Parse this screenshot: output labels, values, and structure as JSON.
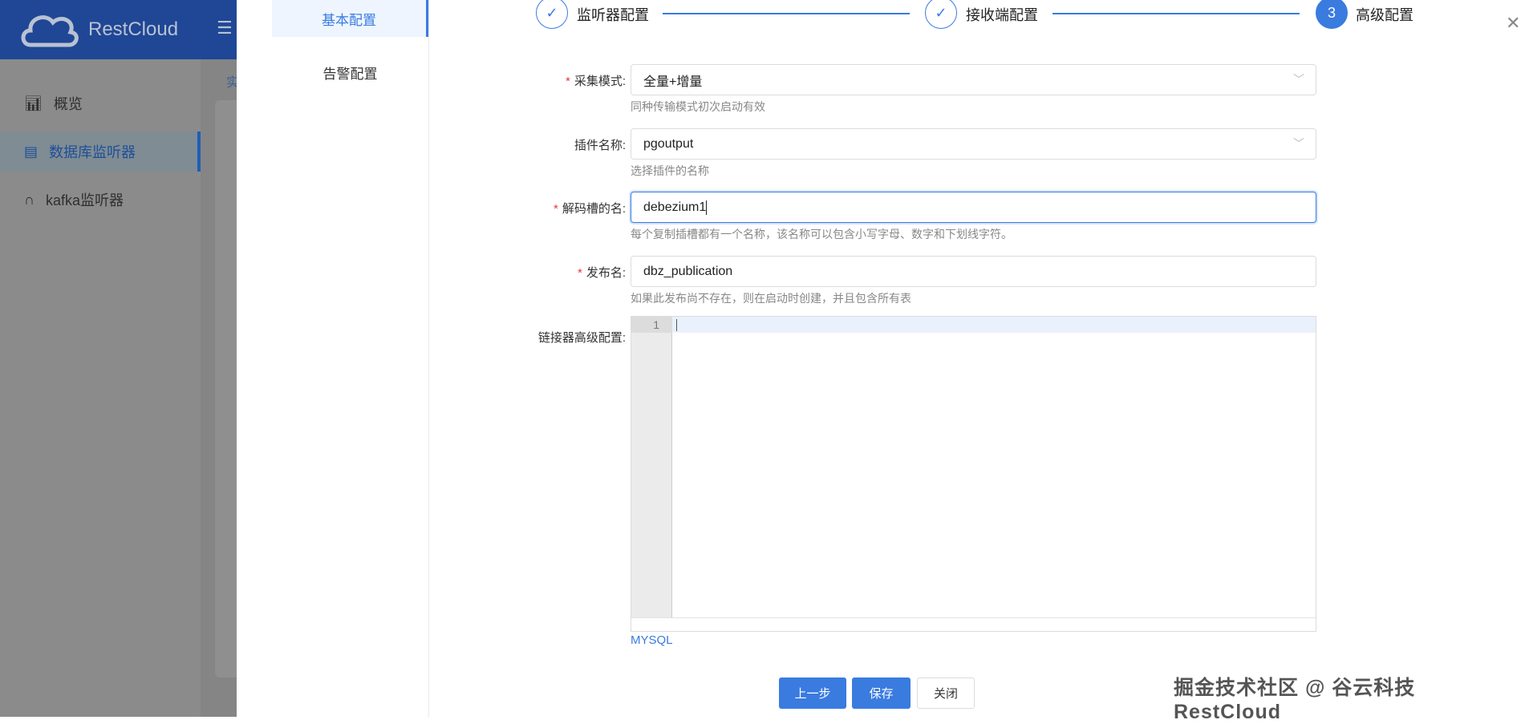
{
  "app": {
    "brand": "RestCloud"
  },
  "sidebar": {
    "items": [
      {
        "label": "概览",
        "icon": "bar-chart-icon"
      },
      {
        "label": "数据库监听器",
        "icon": "database-icon",
        "active": true
      },
      {
        "label": "kafka监听器",
        "icon": "headset-icon"
      }
    ]
  },
  "breadcrumb": "实",
  "drawer": {
    "tabs": [
      {
        "label": "基本配置",
        "active": true
      },
      {
        "label": "告警配置"
      }
    ],
    "steps": [
      {
        "label": "监听器配置",
        "status": "done"
      },
      {
        "label": "接收端配置",
        "status": "done"
      },
      {
        "label": "高级配置",
        "number": "3",
        "status": "current"
      }
    ],
    "form": {
      "mode": {
        "label": "采集模式:",
        "value": "全量+增量",
        "help": "同种传输模式初次启动有效",
        "required": true
      },
      "plugin": {
        "label": "插件名称:",
        "value": "pgoutput",
        "help": "选择插件的名称"
      },
      "slot": {
        "label": "解码槽的名:",
        "value": "debezium1",
        "help": "每个复制插槽都有一个名称，该名称可以包含小写字母、数字和下划线字符。",
        "required": true
      },
      "publication": {
        "label": "发布名:",
        "value": "dbz_publication",
        "help": "如果此发布尚不存在，则在启动时创建，并且包含所有表",
        "required": true
      },
      "advanced": {
        "label": "链接器高级配置:",
        "line_number": "1",
        "mode": "MYSQL"
      }
    },
    "buttons": {
      "prev": "上一步",
      "save": "保存",
      "close": "关闭"
    }
  },
  "watermark": "掘金技术社区 @ 谷云科技RestCloud",
  "colors": {
    "primary": "#3a7be0",
    "header": "#1f4796"
  }
}
